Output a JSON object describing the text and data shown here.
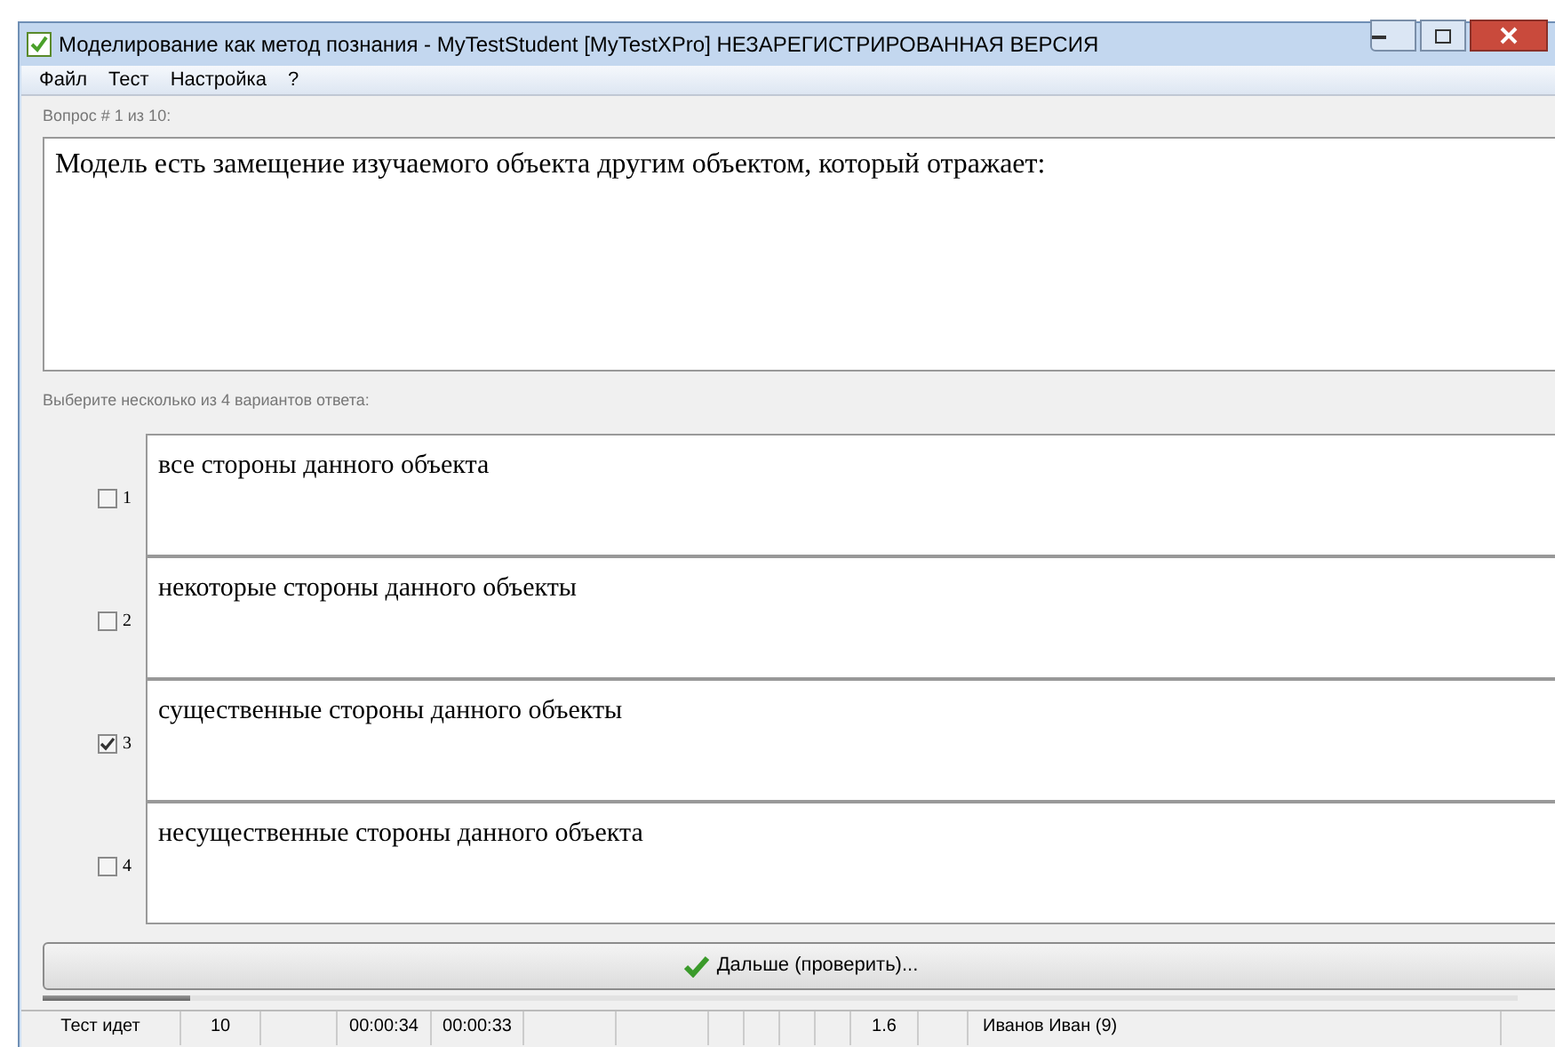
{
  "window": {
    "title": "Моделирование как метод познания - MyTestStudent [MyTestXPro] НЕЗАРЕГИСТРИРОВАННАЯ ВЕРСИЯ"
  },
  "menu": [
    "Файл",
    "Тест",
    "Настройка",
    "?"
  ],
  "question": {
    "header": "Вопрос # 1 из 10:",
    "text": "Модель есть замещение изучаемого объекта другим объектом, который отражает:"
  },
  "answers_prompt": "Выберите несколько из 4 вариантов ответа:",
  "answers": [
    {
      "number": "1",
      "text": "все стороны данного объекта",
      "checked": false
    },
    {
      "number": "2",
      "text": "некоторые стороны данного объекты",
      "checked": false
    },
    {
      "number": "3",
      "text": "существенные стороны данного объекты",
      "checked": true
    },
    {
      "number": "4",
      "text": "несущественные стороны данного объекта",
      "checked": false
    }
  ],
  "next_button": "Дальше (проверить)...",
  "progress": {
    "level": 0.1
  },
  "status_bar": [
    "Тест идет",
    "10",
    "00:00:34",
    "00:00:33",
    "1.6",
    "Иванов Иван (9)"
  ]
}
